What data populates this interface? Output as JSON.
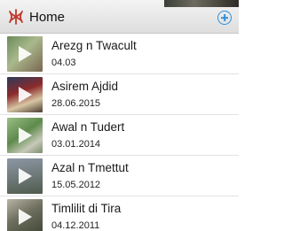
{
  "header": {
    "title": "Home",
    "logo_icon": "amazigh-symbol-icon",
    "add_icon": "add-circle-icon",
    "accent_color": "#2f8fd8",
    "logo_color": "#c0392b"
  },
  "items": [
    {
      "name": "Arezg n Twacult",
      "date": "04.03"
    },
    {
      "name": "Asirem Ajdid",
      "date": "28.06.2015"
    },
    {
      "name": "Awal n Tudert",
      "date": "03.01.2014"
    },
    {
      "name": "Azal n Tmettut",
      "date": "15.05.2012"
    },
    {
      "name": "Timlilit di Tira",
      "date": "04.12.2011"
    }
  ]
}
